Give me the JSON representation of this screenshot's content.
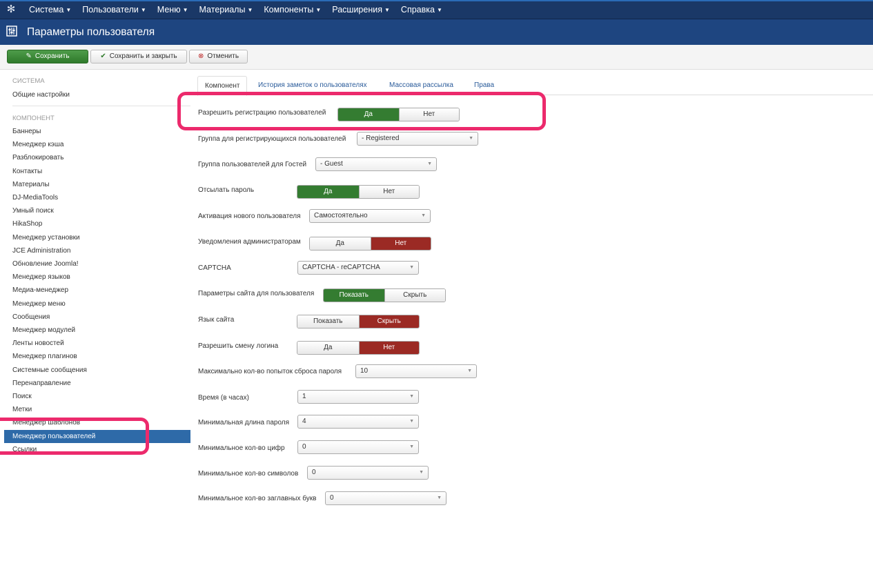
{
  "topnav": {
    "menu": [
      {
        "label": "Система"
      },
      {
        "label": "Пользователи"
      },
      {
        "label": "Меню"
      },
      {
        "label": "Материалы"
      },
      {
        "label": "Компоненты"
      },
      {
        "label": "Расширения"
      },
      {
        "label": "Справка"
      }
    ]
  },
  "header": {
    "title": "Параметры пользователя"
  },
  "toolbar": {
    "save_label": "Сохранить",
    "save_close_label": "Сохранить и закрыть",
    "cancel_label": "Отменить"
  },
  "sidebar": {
    "section_system": "СИСТЕМА",
    "general_settings": "Общие настройки",
    "section_component": "КОМПОНЕНТ",
    "items": [
      "Баннеры",
      "Менеджер кэша",
      "Разблокировать",
      "Контакты",
      "Материалы",
      "DJ-MediaTools",
      "Умный поиск",
      "HikaShop",
      "Менеджер установки",
      "JCE Administration",
      "Обновление Joomla!",
      "Менеджер языков",
      "Медиа-менеджер",
      "Менеджер меню",
      "Сообщения",
      "Менеджер модулей",
      "Ленты новостей",
      "Менеджер плагинов",
      "Системные сообщения",
      "Перенаправление",
      "Поиск",
      "Метки",
      "Менеджер шаблонов",
      "Менеджер пользователей",
      "Ссылки"
    ],
    "active_item": "Менеджер пользователей"
  },
  "tabs": [
    "Компонент",
    "История заметок о пользователях",
    "Массовая рассылка",
    "Права"
  ],
  "form": {
    "allow_registration": {
      "label": "Разрешить регистрацию пользователей",
      "yes": "Да",
      "no": "Нет",
      "selected": "Да"
    },
    "new_user_group": {
      "label": "Группа для регистрирующихся пользователей",
      "value": "- Registered"
    },
    "guest_group": {
      "label": "Группа пользователей для Гостей",
      "value": "- Guest"
    },
    "send_password": {
      "label": "Отсылать пароль",
      "yes": "Да",
      "no": "Нет",
      "selected": "Да"
    },
    "activation": {
      "label": "Активация нового пользователя",
      "value": "Самостоятельно"
    },
    "notify_admins": {
      "label": "Уведомления администраторам",
      "yes": "Да",
      "no": "Нет",
      "selected": "Нет"
    },
    "captcha": {
      "label": "CAPTCHA",
      "value": "CAPTCHA - reCAPTCHA"
    },
    "frontend_params": {
      "label": "Параметры сайта для пользователя",
      "show": "Показать",
      "hide": "Скрыть",
      "selected": "Показать"
    },
    "site_language": {
      "label": "Язык сайта",
      "show": "Показать",
      "hide": "Скрыть",
      "selected": "Скрыть"
    },
    "change_login": {
      "label": "Разрешить смену логина",
      "yes": "Да",
      "no": "Нет",
      "selected": "Нет"
    },
    "reset_count": {
      "label": "Максимально кол-во попыток сброса пароля",
      "value": "10"
    },
    "reset_time": {
      "label": "Время (в часах)",
      "value": "1"
    },
    "min_length": {
      "label": "Минимальная длина пароля",
      "value": "4"
    },
    "min_digits": {
      "label": "Минимальное кол-во цифр",
      "value": "0"
    },
    "min_symbols": {
      "label": "Минимальное кол-во символов",
      "value": "0"
    },
    "min_upper": {
      "label": "Минимальное кол-во заглавных букв",
      "value": "0"
    }
  },
  "colors": {
    "nav": "#1a3867",
    "subhead": "#1e4580",
    "yes_green": "#347c31",
    "no_red": "#9b2a24",
    "highlight": "#ec2a6c",
    "active_sidebar": "#2e6aa8"
  }
}
